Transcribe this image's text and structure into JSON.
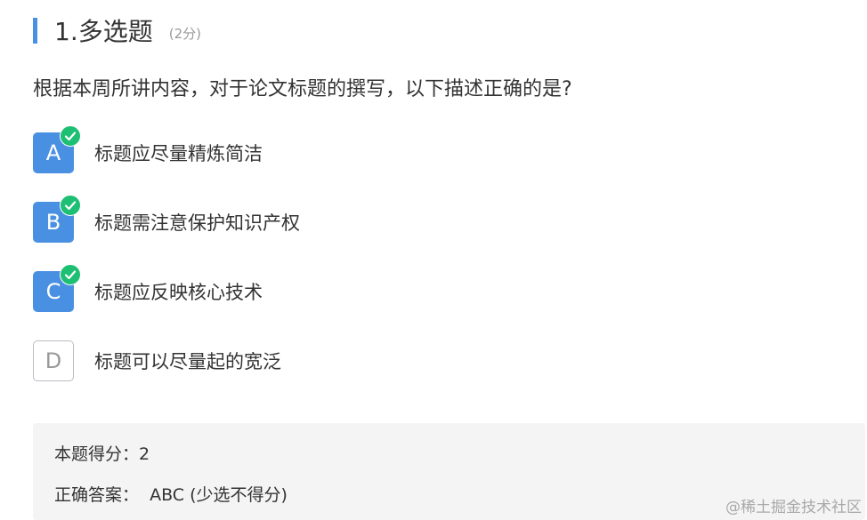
{
  "question": {
    "title": "1.多选题",
    "score": "(2分)",
    "text": "根据本周所讲内容，对于论文标题的撰写，以下描述正确的是?"
  },
  "options": [
    {
      "letter": "A",
      "text": "标题应尽量精炼简洁",
      "selected": true
    },
    {
      "letter": "B",
      "text": "标题需注意保护知识产权",
      "selected": true
    },
    {
      "letter": "C",
      "text": "标题应反映核心技术",
      "selected": true
    },
    {
      "letter": "D",
      "text": "标题可以尽量起的宽泛",
      "selected": false
    }
  ],
  "result": {
    "score_label": "本题得分：",
    "score_value": "2",
    "answer_label": "正确答案：",
    "answer_value": "ABC (少选不得分)"
  },
  "watermark": "@稀土掘金技术社区",
  "colors": {
    "accent": "#4a90e2",
    "check": "#1dbf73",
    "result_bg": "#f4f4f4"
  },
  "icons": {
    "selected_mark": "check-circle-icon"
  }
}
